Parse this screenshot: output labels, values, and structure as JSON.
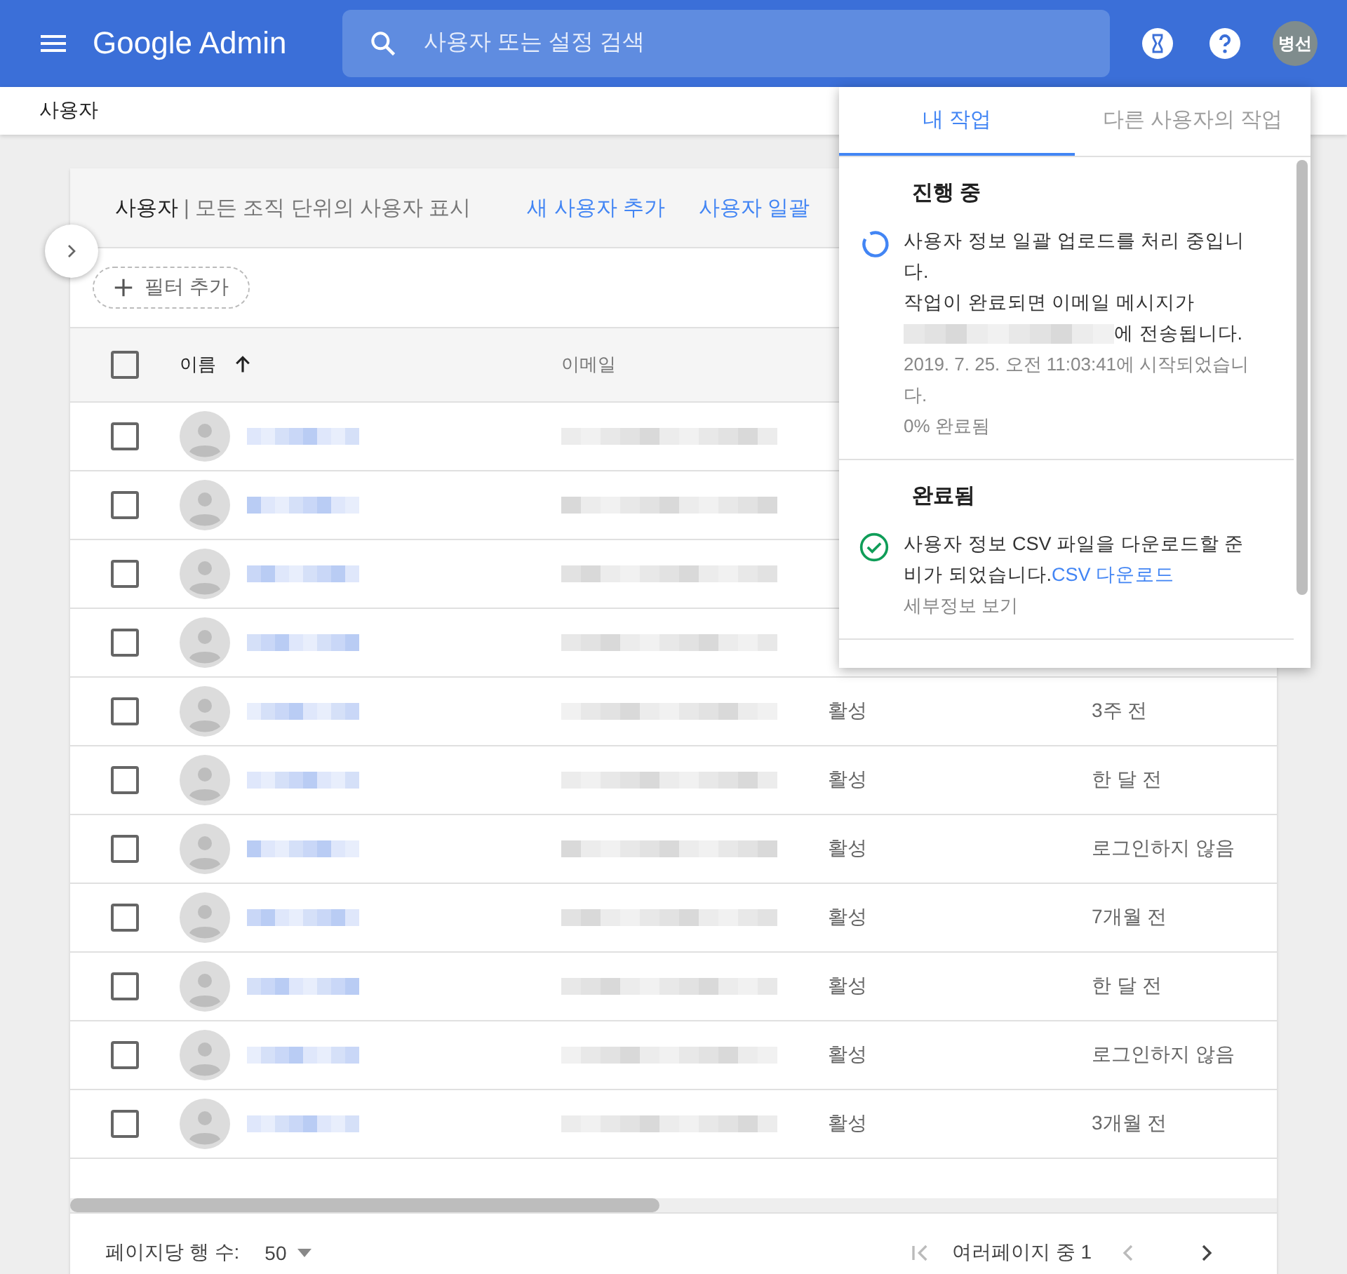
{
  "topbar": {
    "product": "Google Admin",
    "search": {
      "placeholder": "사용자 또는 설정 검색"
    },
    "avatar": "병선"
  },
  "breadcrumb": "사용자",
  "card": {
    "title": "사용자",
    "subtitle": "| 모든 조직 단위의 사용자 표시",
    "actions": [
      "새 사용자 추가",
      "사용자 일괄"
    ],
    "filter": "필터 추가",
    "all_checked": false,
    "columns": [
      {
        "label": "이름",
        "sorted": true
      },
      {
        "label": "이메일",
        "sorted": false
      }
    ],
    "rows": [
      {
        "checked": false
      },
      {
        "checked": false
      },
      {
        "checked": false
      },
      {
        "checked": false
      },
      {
        "checked": false,
        "status": "활성",
        "last_login": "3주 전"
      },
      {
        "checked": false,
        "status": "활성",
        "last_login": "한 달 전"
      },
      {
        "checked": false,
        "status": "활성",
        "last_login": "로그인하지 않음"
      },
      {
        "checked": false,
        "status": "활성",
        "last_login": "7개월 전"
      },
      {
        "checked": false,
        "status": "활성",
        "last_login": "한 달 전"
      },
      {
        "checked": false,
        "status": "활성",
        "last_login": "로그인하지 않음"
      },
      {
        "checked": false,
        "status": "활성",
        "last_login": "3개월 전"
      }
    ],
    "footer": {
      "rows_label": "페이지당 행 수:",
      "rows_value": "50",
      "page_info": "여러페이지 중 1"
    }
  },
  "tasks_popup": {
    "tabs": [
      {
        "label": "내 작업",
        "selected": true
      },
      {
        "label": "다른 사용자의 작업",
        "selected": false
      }
    ],
    "sections": [
      {
        "heading": "진행 중",
        "kind": "progress",
        "lines": [
          "사용자 정보 일괄 업로드를 처리 중입니다.",
          "작업이 완료되면 이메일 메시지가"
        ],
        "after_email": "에 전송됩니다.",
        "meta": [
          "2019. 7. 25. 오전 11:03:41에 시작되었습니다.",
          "0% 완료됨"
        ]
      },
      {
        "heading": "완료됨",
        "kind": "done",
        "lines": [
          "사용자 정보 CSV 파일을 다운로드할 준비가 되었습니다."
        ],
        "link": "CSV 다운로드",
        "meta": [
          "세부정보 보기"
        ]
      }
    ]
  }
}
